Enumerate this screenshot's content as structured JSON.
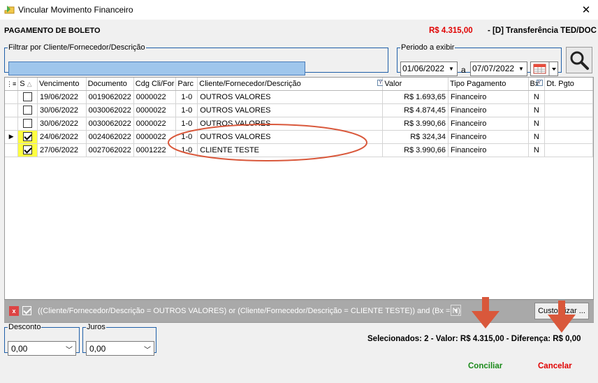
{
  "window": {
    "title": "Vincular Movimento Financeiro",
    "close": "✕"
  },
  "header": {
    "left": "PAGAMENTO DE BOLETO",
    "amount": "R$ 4.315,00",
    "method": "- [D] Transferência TED/DOC"
  },
  "filter": {
    "legend": "Filtrar por Cliente/Fornecedor/Descrição",
    "value": ""
  },
  "period": {
    "legend": "Periodo a exibir",
    "from": "01/06/2022",
    "sep": "a",
    "to": "07/07/2022"
  },
  "grid": {
    "columns": [
      "S",
      "Vencimento",
      "Documento",
      "Cdg Cli/For",
      "Parc",
      "Cliente/Fornecedor/Descrição",
      "Valor",
      "Tipo Pagamento",
      "Bx",
      "Dt. Pgto"
    ],
    "rows": [
      {
        "checked": false,
        "current": false,
        "venc": "19/06/2022",
        "doc": "0019062022",
        "cdg": "0000022",
        "parc": "1-0",
        "cliente": "OUTROS VALORES",
        "valor": "R$ 1.693,65",
        "tipo": "Financeiro",
        "bx": "N",
        "dtpgto": ""
      },
      {
        "checked": false,
        "current": false,
        "venc": "30/06/2022",
        "doc": "0030062022",
        "cdg": "0000022",
        "parc": "1-0",
        "cliente": "OUTROS VALORES",
        "valor": "R$ 4.874,45",
        "tipo": "Financeiro",
        "bx": "N",
        "dtpgto": ""
      },
      {
        "checked": false,
        "current": false,
        "venc": "30/06/2022",
        "doc": "0030062022",
        "cdg": "0000022",
        "parc": "1-0",
        "cliente": "OUTROS VALORES",
        "valor": "R$ 3.990,66",
        "tipo": "Financeiro",
        "bx": "N",
        "dtpgto": ""
      },
      {
        "checked": true,
        "current": true,
        "venc": "24/06/2022",
        "doc": "0024062022",
        "cdg": "0000022",
        "parc": "1-0",
        "cliente": "OUTROS VALORES",
        "valor": "R$ 324,34",
        "tipo": "Financeiro",
        "bx": "N",
        "dtpgto": ""
      },
      {
        "checked": true,
        "current": false,
        "venc": "27/06/2022",
        "doc": "0027062022",
        "cdg": "0001222",
        "parc": "1-0",
        "cliente": "CLIENTE TESTE",
        "valor": "R$ 3.990,66",
        "tipo": "Financeiro",
        "bx": "N",
        "dtpgto": ""
      }
    ]
  },
  "filterbar": {
    "x": "x",
    "expression": "((Cliente/Fornecedor/Descrição = OUTROS VALORES) or (Cliente/Fornecedor/Descrição = CLIENTE TESTE)) and (Bx = N)",
    "customize": "Customizar ..."
  },
  "desconto": {
    "legend": "Desconto",
    "value": "0,00"
  },
  "juros": {
    "legend": "Juros",
    "value": "0,00"
  },
  "summary": "Selecionados: 2  -  Valor: R$ 4.315,00  -  Diferença: R$ 0,00",
  "buttons": {
    "conciliar": "Conciliar",
    "cancelar": "Cancelar"
  },
  "colors": {
    "accent_red": "#e00000",
    "accent_green": "#1a8a1a",
    "annotation": "#d9583b",
    "selection": "#ffff40"
  }
}
